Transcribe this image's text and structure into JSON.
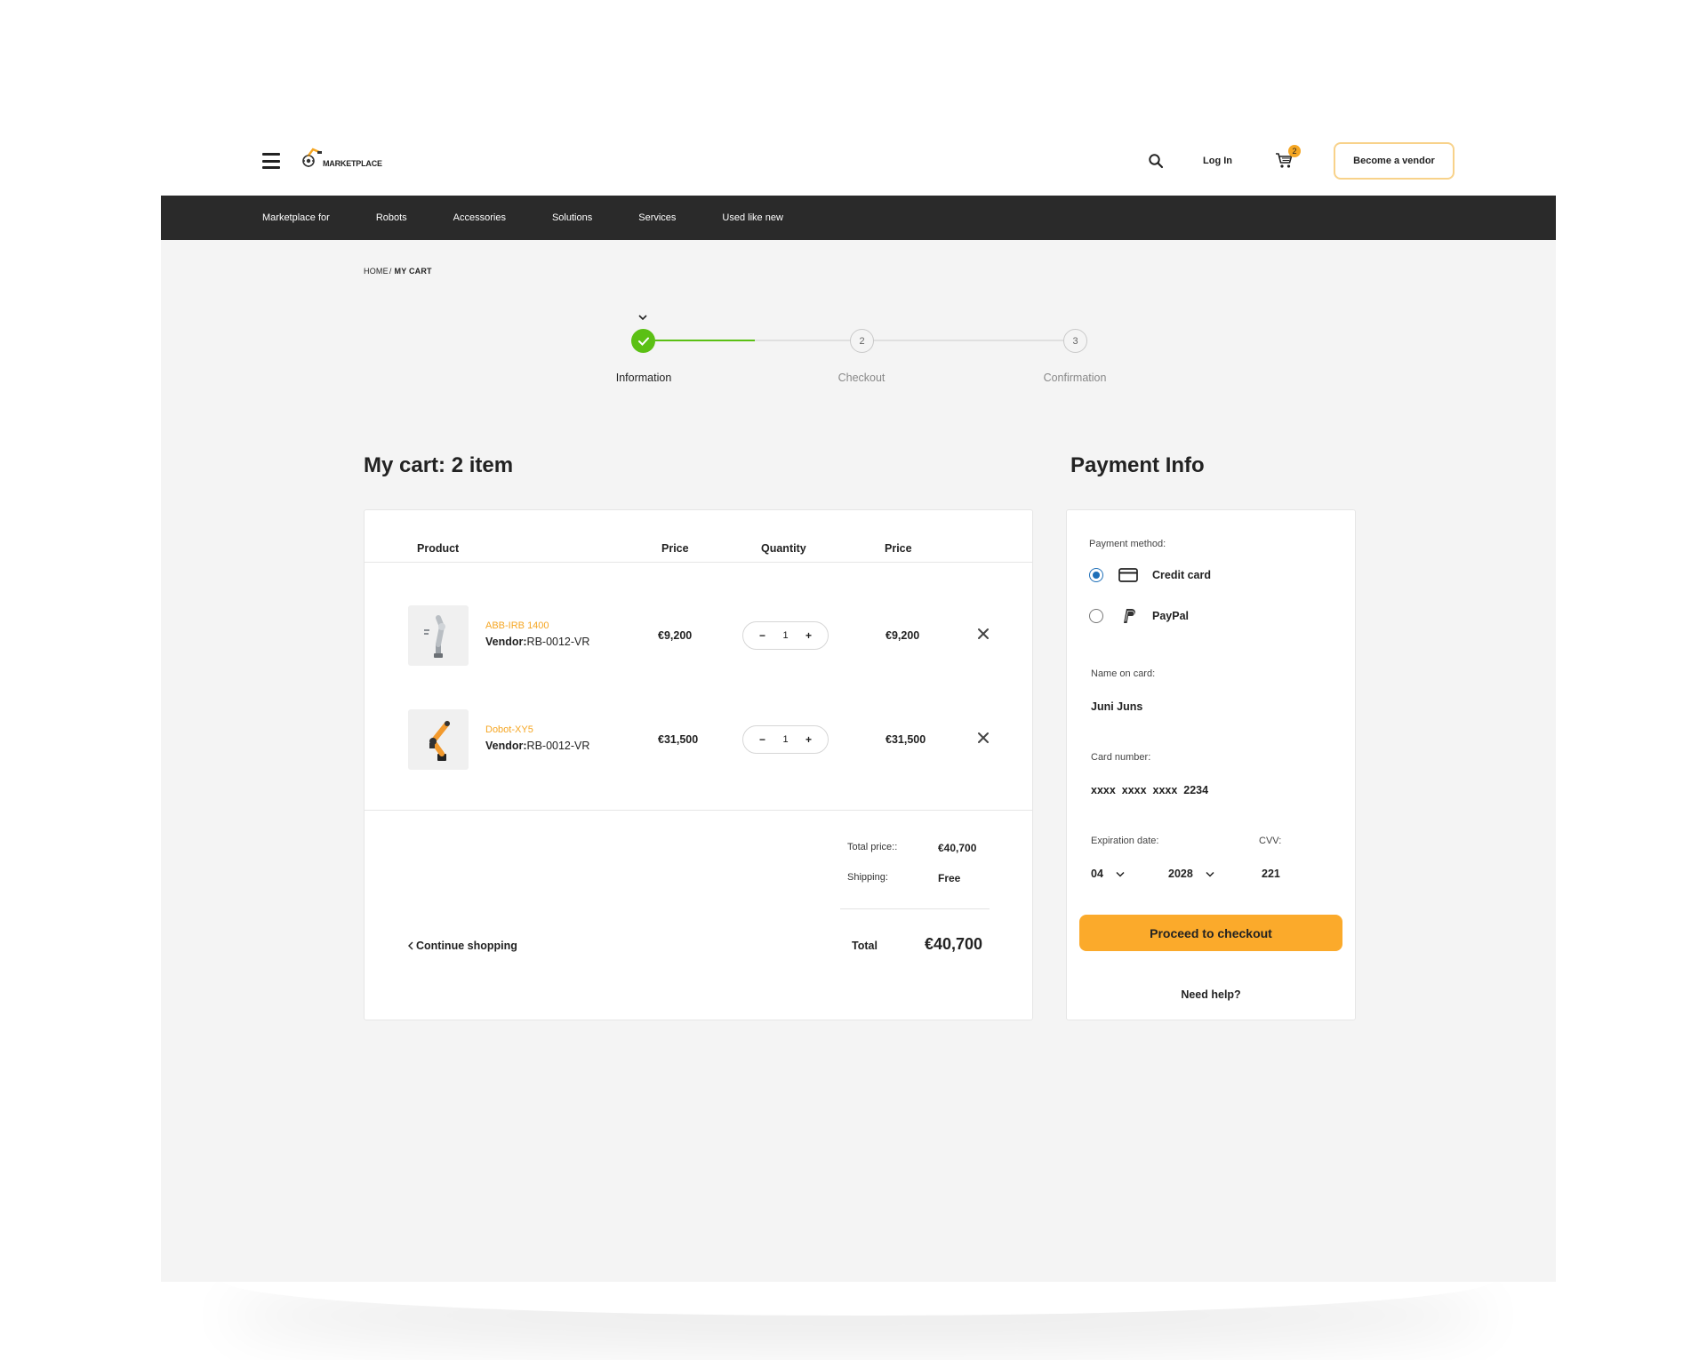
{
  "header": {
    "logo_text": "MARKETPLACE",
    "login_label": "Log In",
    "cart_count": "2",
    "vendor_button": "Become a vendor"
  },
  "nav": {
    "items": [
      "Marketplace for",
      "Robots",
      "Accessories",
      "Solutions",
      "Services",
      "Used like new"
    ]
  },
  "breadcrumb": {
    "home": "HOME",
    "separator": "/",
    "current": "MY CART"
  },
  "stepper": {
    "steps": [
      {
        "number": "",
        "label": "Information",
        "state": "done"
      },
      {
        "number": "2",
        "label": "Checkout",
        "state": "pending"
      },
      {
        "number": "3",
        "label": "Confirmation",
        "state": "pending"
      }
    ],
    "progress_color": "#5bc014"
  },
  "cart": {
    "title": "My cart: 2 item",
    "headers": {
      "product": "Product",
      "price": "Price",
      "quantity": "Quantity",
      "total_price": "Price"
    },
    "items": [
      {
        "name": "ABB-IRB 1400",
        "vendor_label": "Vendor:",
        "vendor_id": "RB-0012-VR",
        "price": "€9,200",
        "quantity": "1",
        "line_total": "€9,200"
      },
      {
        "name": "Dobot-XY5",
        "vendor_label": "Vendor:",
        "vendor_id": "RB-0012-VR",
        "price": "€31,500",
        "quantity": "1",
        "line_total": "€31,500"
      }
    ],
    "summary": {
      "total_price_label": "Total price::",
      "total_price_value": "€40,700",
      "shipping_label": "Shipping:",
      "shipping_value": "Free",
      "total_label": "Total",
      "total_value": "€40,700"
    },
    "continue_label": "Continue shopping"
  },
  "payment": {
    "title": "Payment Info",
    "method_label": "Payment method:",
    "methods": [
      {
        "label": "Credit card",
        "icon": "credit-card-icon",
        "selected": true
      },
      {
        "label": "PayPal",
        "icon": "paypal-icon",
        "selected": false
      }
    ],
    "name_label": "Name on card:",
    "name_value": "Juni Juns",
    "card_label": "Card number:",
    "card_value": "xxxx  xxxx  xxxx  2234",
    "expiration_label": "Expiration date:",
    "exp_month": "04",
    "exp_year": "2028",
    "cvv_label": "CVV:",
    "cvv_value": "221",
    "checkout_button": "Proceed to checkout",
    "help_label": "Need help?"
  },
  "colors": {
    "accent": "#fbaa2b",
    "navbar": "#2a2a2a",
    "success": "#5bc014",
    "radio_selected": "#1e6fb8",
    "product_link": "#f5a623"
  }
}
